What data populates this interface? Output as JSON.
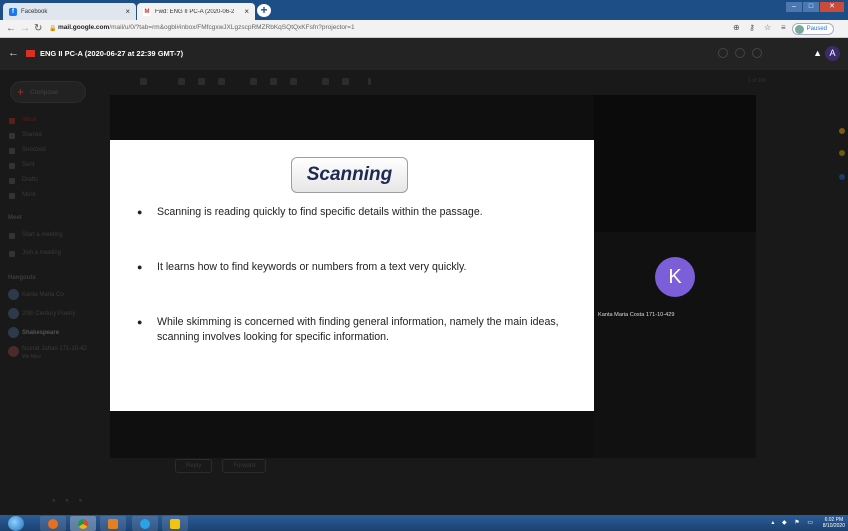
{
  "browser": {
    "tabs": [
      {
        "label": "Facebook",
        "active": false
      },
      {
        "label": "Fwd: ENG II PC-A (2020-06-2",
        "active": true
      }
    ],
    "url_host": "mail.google.com",
    "url_path": "/mail/u/0/?tab=rm&ogbl#inbox/FMfcgxwJXLgzscpRMZRbKqSQtQxKFsfn?projector=1",
    "profile_status": "Paused"
  },
  "gmail": {
    "email_title": "ENG II PC-A (2020-06-27 at 22:39 GMT-7)",
    "sidebar": {
      "compose_label": "Compose",
      "items": [
        "Inbox",
        "Starred",
        "Snoozed",
        "Sent",
        "Drafts",
        "More"
      ],
      "meet_header": "Meet",
      "meet_items": [
        "Start a meeting",
        "Join a meeting"
      ],
      "hangouts_header": "Hangouts",
      "hangouts": [
        "Kanta Maria Co",
        "20th Century Poetry",
        "Shakespeare",
        "Nusrat Jahan 171-10-42"
      ],
      "hangouts_sub": "We Miss"
    },
    "pager_text": "1 of 100",
    "reply_label": "Reply",
    "forward_label": "Forward",
    "user_initial": "A",
    "accent": "#d93025"
  },
  "slide": {
    "title": "Scanning",
    "bullets": [
      "Scanning is reading quickly to find specific details within the passage.",
      "It learns how to find keywords or numbers from a text very quickly.",
      "While skimming is concerned with finding general information, namely the main ideas, scanning involves looking for specific information."
    ]
  },
  "participant": {
    "initial": "K",
    "name": "Kanta Maria Costa 171-10-429",
    "avatar_color": "#7b5ed8"
  },
  "taskbar": {
    "time": "6:02 PM",
    "date": "8/10/2020"
  }
}
